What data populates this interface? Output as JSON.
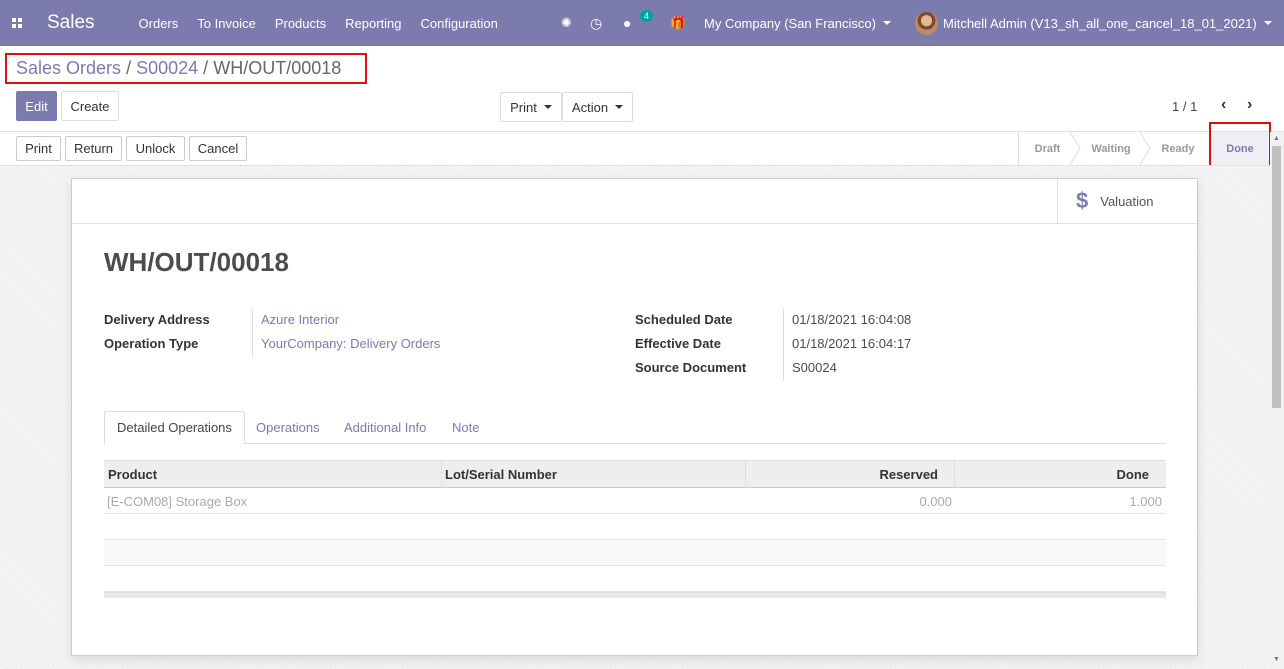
{
  "navbar": {
    "brand": "Sales",
    "menu": [
      "Orders",
      "To Invoice",
      "Products",
      "Reporting",
      "Configuration"
    ],
    "chat_count": "4",
    "company": "My Company (San Francisco)",
    "user": "Mitchell Admin (V13_sh_all_one_cancel_18_01_2021)"
  },
  "breadcrumb": {
    "level1": "Sales Orders",
    "level2": "S00024",
    "current": "WH/OUT/00018",
    "separator": "/"
  },
  "control": {
    "edit": "Edit",
    "create": "Create",
    "print": "Print",
    "action": "Action",
    "pager": "1 / 1"
  },
  "statusbar": {
    "buttons": [
      "Print",
      "Return",
      "Unlock",
      "Cancel"
    ],
    "stages": [
      "Draft",
      "Waiting",
      "Ready",
      "Done"
    ],
    "current_stage": "Done"
  },
  "sheet": {
    "valuation_label": "Valuation",
    "title": "WH/OUT/00018",
    "left_fields": [
      {
        "label": "Delivery Address",
        "value": "Azure Interior"
      },
      {
        "label": "Operation Type",
        "value": "YourCompany: Delivery Orders"
      }
    ],
    "right_fields": [
      {
        "label": "Scheduled Date",
        "value": "01/18/2021 16:04:08"
      },
      {
        "label": "Effective Date",
        "value": "01/18/2021 16:04:17"
      },
      {
        "label": "Source Document",
        "value": "S00024"
      }
    ],
    "tabs": [
      "Detailed Operations",
      "Operations",
      "Additional Info",
      "Note"
    ],
    "active_tab": "Detailed Operations",
    "table": {
      "headers": [
        "Product",
        "Lot/Serial Number",
        "Reserved",
        "Done"
      ],
      "rows": [
        {
          "product": "[E-COM08] Storage Box",
          "lot": "",
          "reserved": "0.000",
          "done": "1.000"
        }
      ]
    }
  },
  "colors": {
    "brand": "#7c7bad",
    "highlight_border": "#dd1111"
  }
}
